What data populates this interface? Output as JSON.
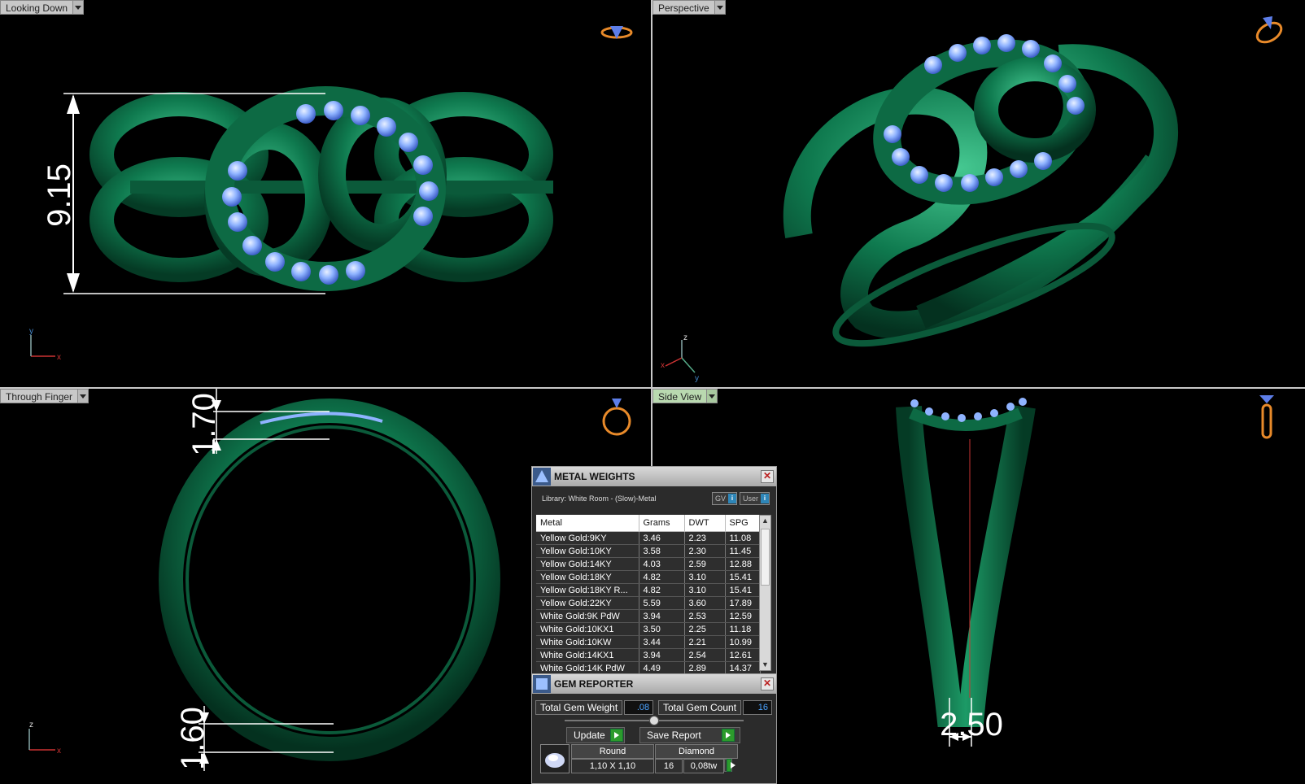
{
  "viewports": {
    "top_left": {
      "label": "Looking Down",
      "dimension": "9.15",
      "axes": [
        "y",
        "x"
      ]
    },
    "top_right": {
      "label": "Perspective",
      "axes": [
        "z",
        "x",
        "y"
      ]
    },
    "bottom_left": {
      "label": "Through Finger",
      "dimensions": [
        "1.70",
        "1.60"
      ],
      "axes": [
        "z",
        "x"
      ]
    },
    "bottom_right": {
      "label": "Side View",
      "dimension": "2.50"
    }
  },
  "colors": {
    "metal": "#0f7a4f",
    "gem": "#8fb3ff",
    "dimension": "#ffffff",
    "active_label": "#b9d9b0"
  },
  "metal_weights": {
    "title": "METAL WEIGHTS",
    "library": "Library: White Room - (Slow)-Metal",
    "toggle_gv": "GV",
    "toggle_user": "User",
    "columns": [
      "Metal",
      "Grams",
      "DWT",
      "SPG"
    ],
    "rows": [
      [
        "Yellow Gold:9KY",
        "3.46",
        "2.23",
        "11.08"
      ],
      [
        "Yellow Gold:10KY",
        "3.58",
        "2.30",
        "11.45"
      ],
      [
        "Yellow Gold:14KY",
        "4.03",
        "2.59",
        "12.88"
      ],
      [
        "Yellow Gold:18KY",
        "4.82",
        "3.10",
        "15.41"
      ],
      [
        "Yellow Gold:18KY R...",
        "4.82",
        "3.10",
        "15.41"
      ],
      [
        "Yellow Gold:22KY",
        "5.59",
        "3.60",
        "17.89"
      ],
      [
        "White Gold:9K PdW",
        "3.94",
        "2.53",
        "12.59"
      ],
      [
        "White Gold:10KX1",
        "3.50",
        "2.25",
        "11.18"
      ],
      [
        "White Gold:10KW",
        "3.44",
        "2.21",
        "10.99"
      ],
      [
        "White Gold:14KX1",
        "3.94",
        "2.54",
        "12.61"
      ],
      [
        "White Gold:14K PdW",
        "4.49",
        "2.89",
        "14.37"
      ]
    ]
  },
  "gem_reporter": {
    "title": "GEM REPORTER",
    "total_weight_label": "Total Gem Weight",
    "total_weight": ".08",
    "total_count_label": "Total Gem Count",
    "total_count": "16",
    "update_label": "Update",
    "save_label": "Save Report",
    "gem": {
      "shape": "Round",
      "type": "Diamond",
      "size": "1,10 X 1,10",
      "count": "16",
      "weight": "0,08tw"
    }
  }
}
